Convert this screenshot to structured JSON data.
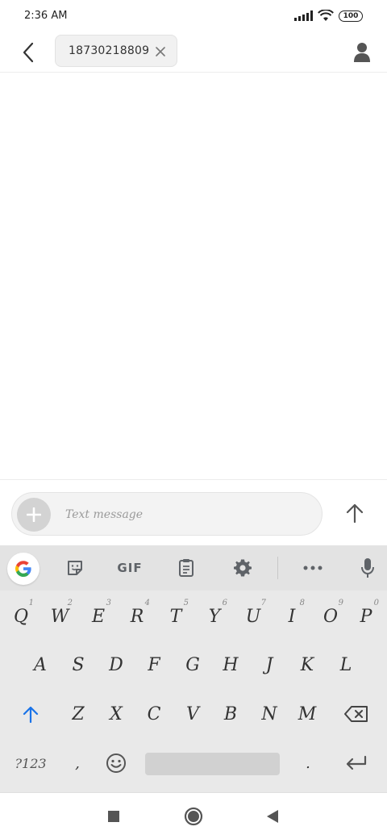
{
  "status_bar": {
    "time": "2:36 AM",
    "battery": "100",
    "icons": [
      "signal-icon",
      "wifi-icon",
      "battery-icon"
    ]
  },
  "header": {
    "back_icon": "back-chevron-icon",
    "recipient": "18730218809",
    "clear_icon": "close-icon",
    "contact_icon": "person-icon"
  },
  "compose": {
    "add_icon": "plus-icon",
    "placeholder": "Text message",
    "send_icon": "arrow-up-icon"
  },
  "keyboard": {
    "toolbar": {
      "google_icon": "google-g-icon",
      "sticker_icon": "sticker-icon",
      "gif_label": "GIF",
      "clipboard_icon": "clipboard-icon",
      "settings_icon": "gear-icon",
      "more_icon": "more-horizontal-icon",
      "mic_icon": "microphone-icon"
    },
    "row1": [
      {
        "key": "Q",
        "hint": "1"
      },
      {
        "key": "W",
        "hint": "2"
      },
      {
        "key": "E",
        "hint": "3"
      },
      {
        "key": "R",
        "hint": "4"
      },
      {
        "key": "T",
        "hint": "5"
      },
      {
        "key": "Y",
        "hint": "6"
      },
      {
        "key": "U",
        "hint": "7"
      },
      {
        "key": "I",
        "hint": "8"
      },
      {
        "key": "O",
        "hint": "9"
      },
      {
        "key": "P",
        "hint": "0"
      }
    ],
    "row2": [
      "A",
      "S",
      "D",
      "F",
      "G",
      "H",
      "J",
      "K",
      "L"
    ],
    "row3": [
      "Z",
      "X",
      "C",
      "V",
      "B",
      "N",
      "M"
    ],
    "symbols_label": "?123",
    "comma": ",",
    "period": ".",
    "shift_icon": "shift-arrow-icon",
    "backspace_icon": "backspace-icon",
    "emoji_icon": "emoji-icon",
    "enter_icon": "enter-icon"
  },
  "navbar": {
    "recents_icon": "square-icon",
    "home_icon": "circle-icon",
    "back_icon": "triangle-back-icon"
  },
  "colors": {
    "accent_blue": "#1a73e8",
    "keyboard_bg": "#e9e9e9",
    "toolbar_bg": "#e3e3e3",
    "icon_gray": "#5f6368"
  }
}
